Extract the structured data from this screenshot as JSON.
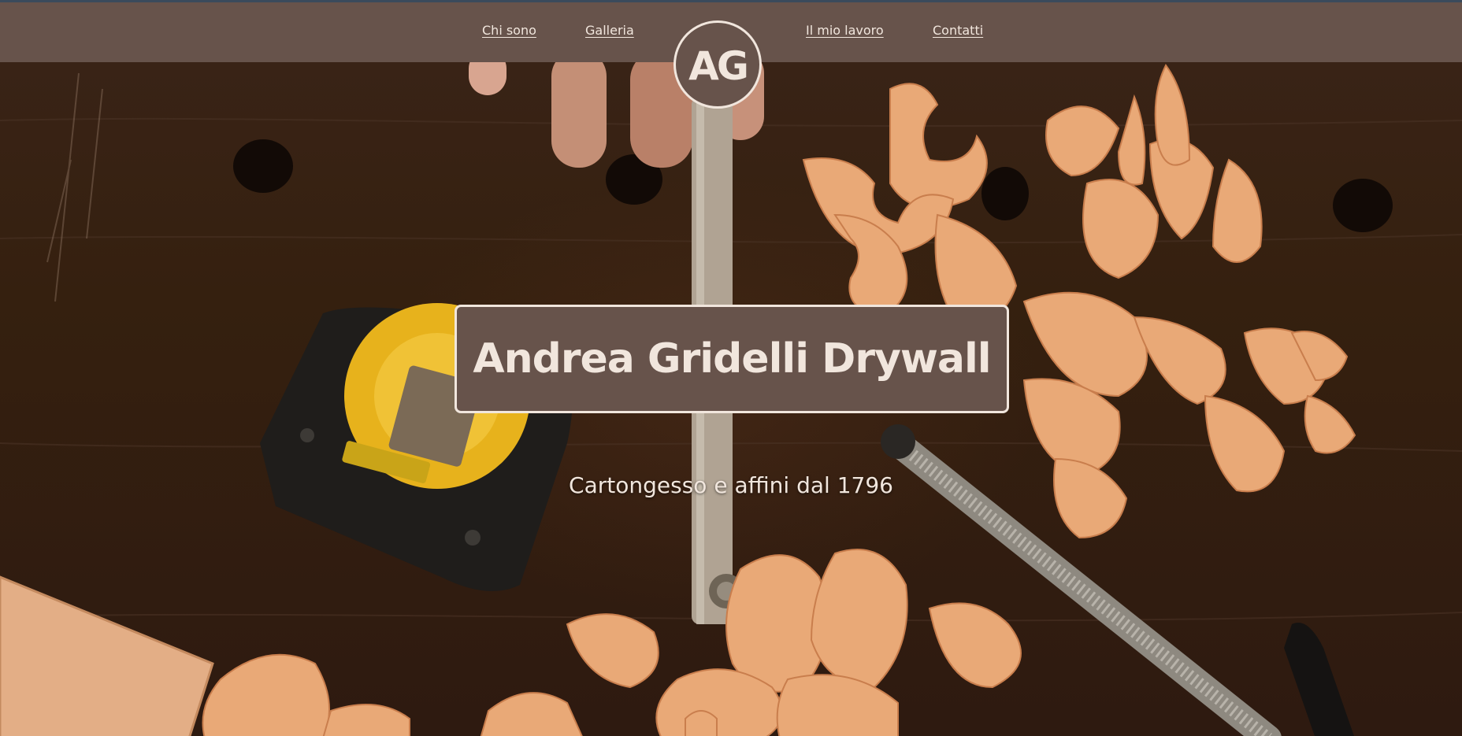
{
  "nav": {
    "links": [
      {
        "label": "Chi sono"
      },
      {
        "label": "Galleria"
      },
      {
        "label": "Il mio lavoro"
      },
      {
        "label": "Contatti"
      }
    ],
    "logo_text": "AG"
  },
  "hero": {
    "title": "Andrea Gridelli Drywall",
    "subtitle": "Cartongesso e affini dal 1796"
  },
  "colors": {
    "nav_background": "#67534b",
    "text_light": "#f1e6dd",
    "wood_dark": "#35200f"
  }
}
